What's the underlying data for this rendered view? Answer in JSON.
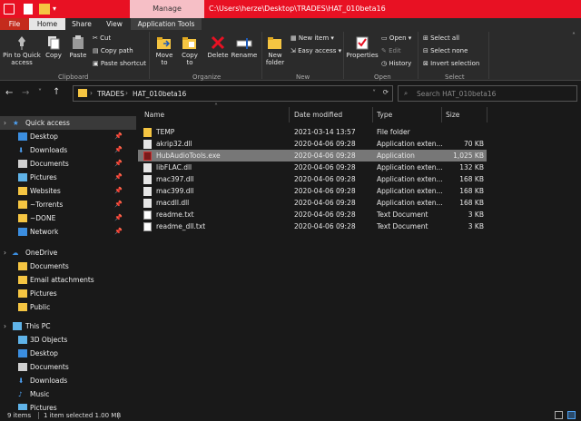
{
  "titlebar": {
    "manage_label": "Manage",
    "path": "C:\\Users\\herze\\Desktop\\TRADES\\HAT_010beta16"
  },
  "tabs": [
    "File",
    "Home",
    "Share",
    "View",
    "Application Tools"
  ],
  "ribbon": {
    "clipboard": {
      "pin": "Pin to Quick access",
      "copy": "Copy",
      "paste": "Paste",
      "cut": "Cut",
      "copy_path": "Copy path",
      "paste_shortcut": "Paste shortcut",
      "label": "Clipboard"
    },
    "organize": {
      "move_to": "Move to",
      "copy_to": "Copy to",
      "delete": "Delete",
      "rename": "Rename",
      "label": "Organize"
    },
    "new": {
      "new_folder": "New folder",
      "new_item": "New item",
      "easy_access": "Easy access",
      "label": "New"
    },
    "open": {
      "properties": "Properties",
      "open": "Open",
      "edit": "Edit",
      "history": "History",
      "label": "Open"
    },
    "select": {
      "select_all": "Select all",
      "select_none": "Select none",
      "invert": "Invert selection",
      "label": "Select"
    }
  },
  "address": {
    "crumb1": "TRADES",
    "crumb2": "HAT_010beta16",
    "search_placeholder": "Search HAT_010beta16"
  },
  "nav": {
    "quick_access": "Quick access",
    "qa_items": [
      "Desktop",
      "Downloads",
      "Documents",
      "Pictures",
      "Websites",
      "~Torrents",
      "~DONE",
      "Network"
    ],
    "onedrive": "OneDrive",
    "od_items": [
      "Documents",
      "Email attachments",
      "Pictures",
      "Public"
    ],
    "this_pc": "This PC",
    "pc_items": [
      "3D Objects",
      "Desktop",
      "Documents",
      "Downloads",
      "Music",
      "Pictures"
    ]
  },
  "columns": {
    "name": "Name",
    "date": "Date modified",
    "type": "Type",
    "size": "Size"
  },
  "files": [
    {
      "name": "TEMP",
      "date": "2021-03-14 13:57",
      "type": "File folder",
      "size": ""
    },
    {
      "name": "akrip32.dll",
      "date": "2020-04-06 09:28",
      "type": "Application exten...",
      "size": "70 KB"
    },
    {
      "name": "HubAudioTools.exe",
      "date": "2020-04-06 09:28",
      "type": "Application",
      "size": "1,025 KB"
    },
    {
      "name": "libFLAC.dll",
      "date": "2020-04-06 09:28",
      "type": "Application exten...",
      "size": "132 KB"
    },
    {
      "name": "mac397.dll",
      "date": "2020-04-06 09:28",
      "type": "Application exten...",
      "size": "168 KB"
    },
    {
      "name": "mac399.dll",
      "date": "2020-04-06 09:28",
      "type": "Application exten...",
      "size": "168 KB"
    },
    {
      "name": "macdll.dll",
      "date": "2020-04-06 09:28",
      "type": "Application exten...",
      "size": "168 KB"
    },
    {
      "name": "readme.txt",
      "date": "2020-04-06 09:28",
      "type": "Text Document",
      "size": "3 KB"
    },
    {
      "name": "readme_dll.txt",
      "date": "2020-04-06 09:28",
      "type": "Text Document",
      "size": "3 KB"
    }
  ],
  "status": {
    "items": "9 items",
    "selected": "1 item selected  1.00 MB"
  }
}
